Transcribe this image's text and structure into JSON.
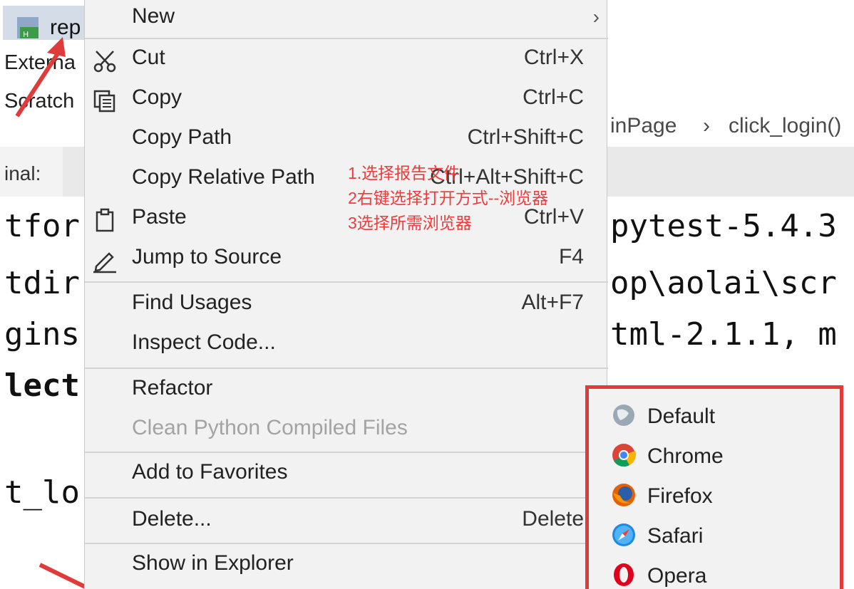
{
  "project_tree": {
    "file_label": "rep",
    "external_label": "Externa",
    "scratch_label": "Scratch"
  },
  "breadcrumb": {
    "class_crumb": "inPage",
    "separator": "›",
    "method_crumb": "click_login()"
  },
  "terminal": {
    "tab_label": "inal:",
    "lines": [
      "tfor",
      "tdir",
      "gins",
      "lect",
      "t_lo"
    ],
    "lines_right": [
      "pytest-5.4.3",
      "op\\aolai\\scr",
      "tml-2.1.1, m"
    ]
  },
  "context_menu": {
    "items": [
      {
        "label": "New",
        "shortcut": "",
        "icon": "",
        "submenu": true,
        "disabled": false
      },
      {
        "label": "Cut",
        "shortcut": "Ctrl+X",
        "icon": "scissors-icon",
        "submenu": false,
        "disabled": false
      },
      {
        "label": "Copy",
        "shortcut": "Ctrl+C",
        "icon": "copy-icon",
        "submenu": false,
        "disabled": false
      },
      {
        "label": "Copy Path",
        "shortcut": "Ctrl+Shift+C",
        "icon": "",
        "submenu": false,
        "disabled": false
      },
      {
        "label": "Copy Relative Path",
        "shortcut": "Ctrl+Alt+Shift+C",
        "icon": "",
        "submenu": false,
        "disabled": false
      },
      {
        "label": "Paste",
        "shortcut": "Ctrl+V",
        "icon": "clipboard-icon",
        "submenu": false,
        "disabled": false
      },
      {
        "label": "Jump to Source",
        "shortcut": "F4",
        "icon": "pencil-icon",
        "submenu": false,
        "disabled": false
      },
      {
        "label": "Find Usages",
        "shortcut": "Alt+F7",
        "icon": "",
        "submenu": false,
        "disabled": false
      },
      {
        "label": "Inspect Code...",
        "shortcut": "",
        "icon": "",
        "submenu": false,
        "disabled": false
      },
      {
        "label": "Refactor",
        "shortcut": "",
        "icon": "",
        "submenu": true,
        "disabled": false
      },
      {
        "label": "Clean Python Compiled Files",
        "shortcut": "",
        "icon": "",
        "submenu": false,
        "disabled": true
      },
      {
        "label": "Add to Favorites",
        "shortcut": "",
        "icon": "",
        "submenu": true,
        "disabled": false
      },
      {
        "label": "Delete...",
        "shortcut": "Delete",
        "icon": "",
        "submenu": false,
        "disabled": false
      },
      {
        "label": "Show in Explorer",
        "shortcut": "",
        "icon": "",
        "submenu": false,
        "disabled": false
      }
    ]
  },
  "annotation": {
    "line1": "1.选择报告文件",
    "line2": "2右键选择打开方式--浏览器",
    "line3": "3选择所需浏览器"
  },
  "browser_menu": {
    "items": [
      {
        "label": "Default",
        "icon": "default-browser-icon"
      },
      {
        "label": "Chrome",
        "icon": "chrome-icon"
      },
      {
        "label": "Firefox",
        "icon": "firefox-icon"
      },
      {
        "label": "Safari",
        "icon": "safari-icon"
      },
      {
        "label": "Opera",
        "icon": "opera-icon"
      }
    ],
    "highlight_color": "#e23a3a"
  },
  "colors": {
    "menu_background": "#f2f2f2",
    "annotation_red": "#ee3b3b",
    "disabled_text": "#a3a3a3"
  }
}
